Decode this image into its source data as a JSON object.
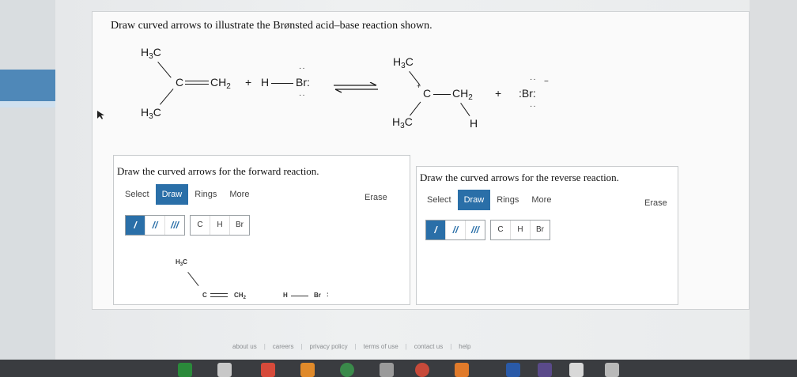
{
  "question": "Draw curved arrows to illustrate the Brønsted acid–base reaction shown.",
  "reaction": {
    "h3c": "H",
    "h3c_sub": "3",
    "h3c_c": "C",
    "carbon": "C",
    "ch2": "CH",
    "ch2_sub": "2",
    "plus": "+",
    "h": "H",
    "br": "Br:",
    "br_left": ":Br:",
    "br_dots_top": "··",
    "br_dots_bottom": "··",
    "charge_plus": "+",
    "charge_minus": "−"
  },
  "forward": {
    "title": "Draw the curved arrows for the forward reaction.",
    "tabs": [
      "Select",
      "Draw",
      "Rings",
      "More"
    ],
    "erase": "Erase",
    "bond_tools": [
      "/",
      "//",
      "///"
    ],
    "atom_tools": [
      "C",
      "H",
      "Br"
    ],
    "canvas": {
      "h3c": "H",
      "h3c_sub": "3",
      "h3c_c": "C",
      "c": "C",
      "ch2": "CH",
      "ch2_sub": "2",
      "h": "H",
      "br": "Br",
      "br_colon": ":"
    }
  },
  "reverse": {
    "title": "Draw the curved arrows for the reverse reaction.",
    "tabs": [
      "Select",
      "Draw",
      "Rings",
      "More"
    ],
    "erase": "Erase",
    "bond_tools": [
      "/",
      "//",
      "///"
    ],
    "atom_tools": [
      "C",
      "H",
      "Br"
    ]
  },
  "footer": [
    "about us",
    "careers",
    "privacy policy",
    "terms of use",
    "contact us",
    "help"
  ],
  "colors": {
    "accent": "#2a6fa8",
    "panel": "#fafafa"
  }
}
